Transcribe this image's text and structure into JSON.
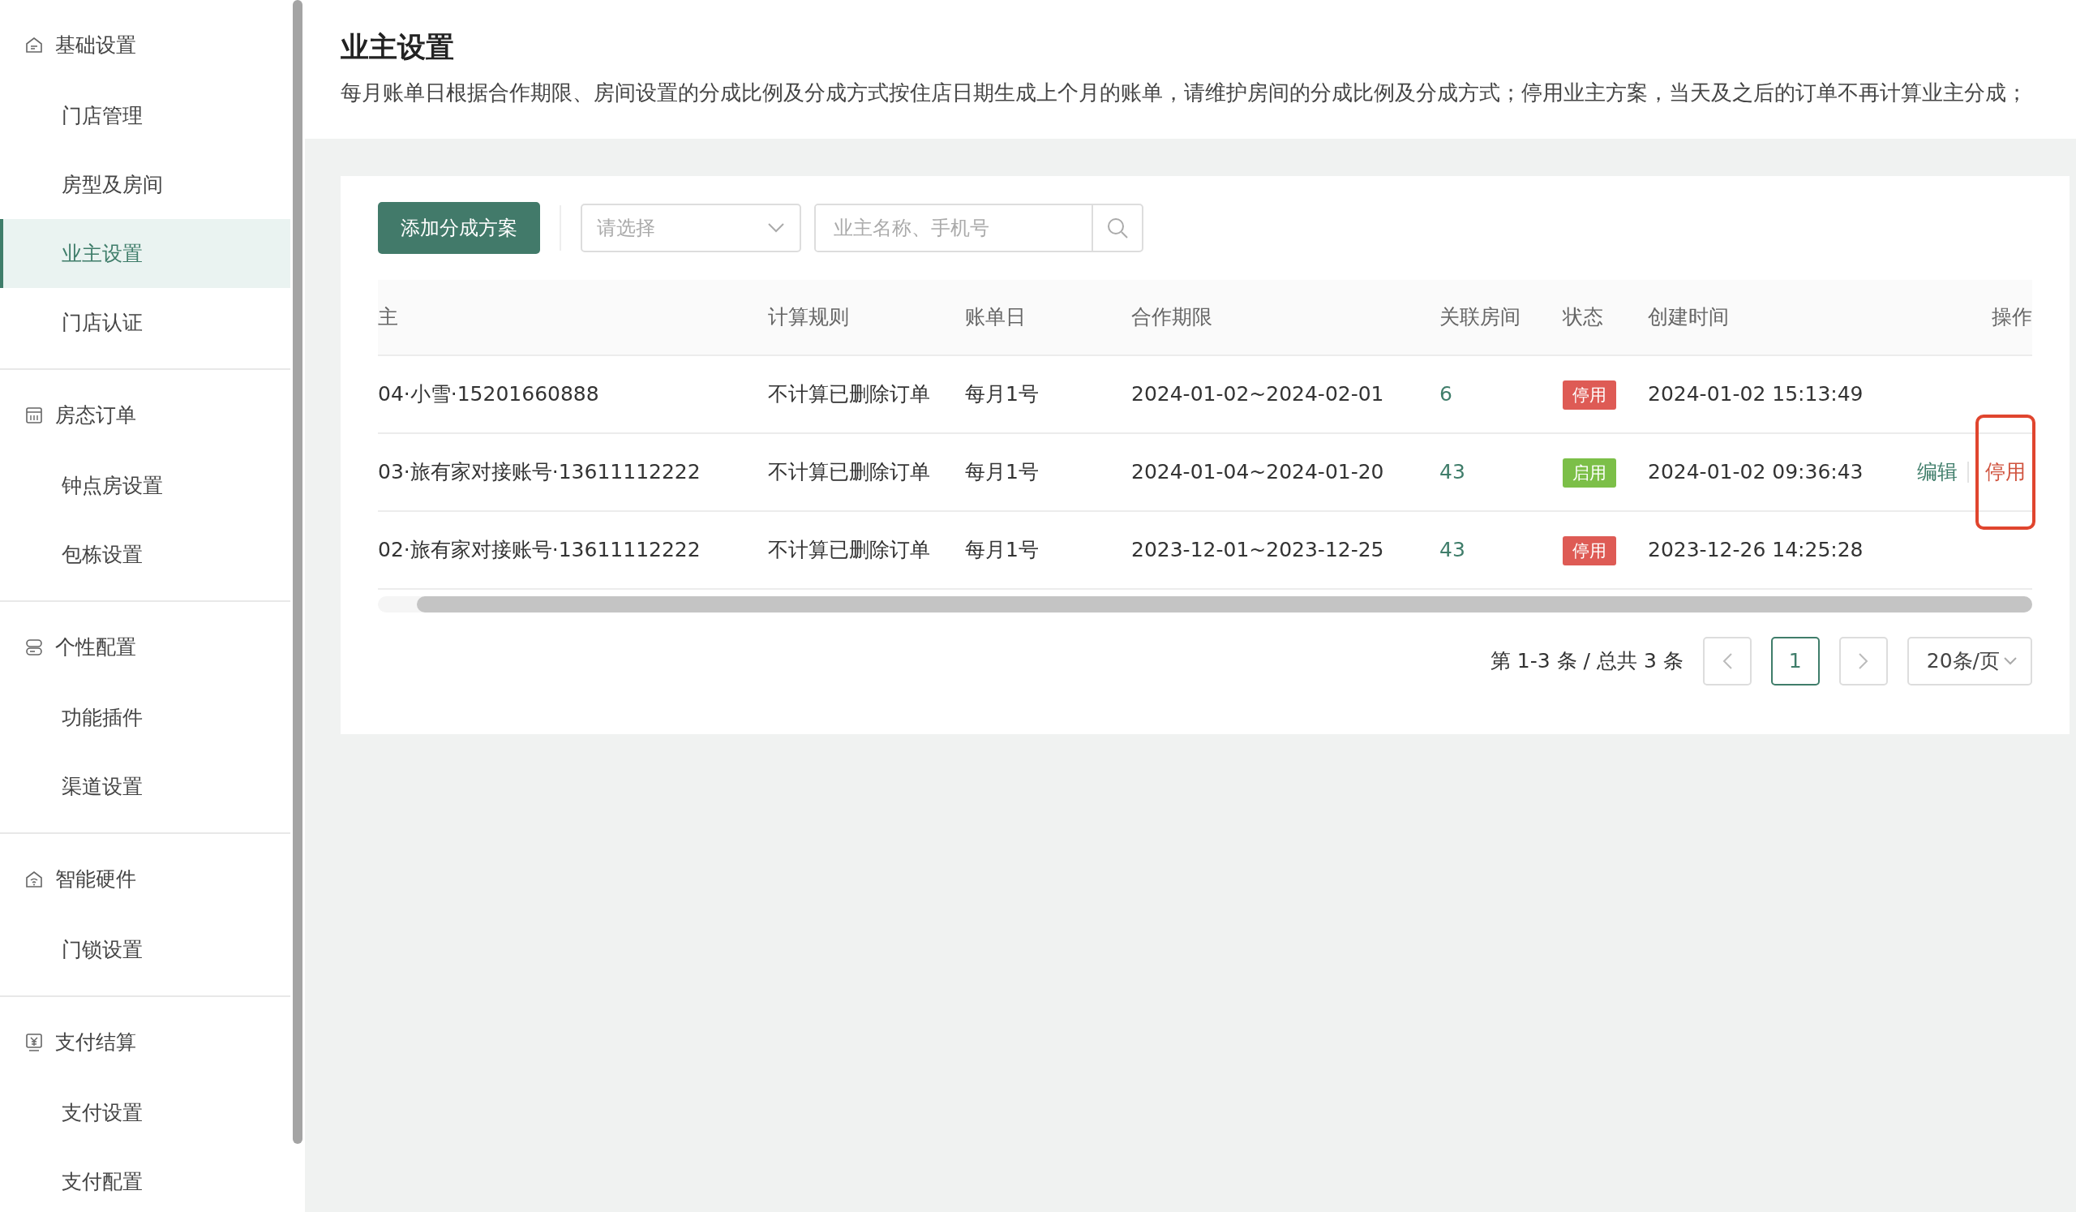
{
  "sidebar": {
    "groups": [
      {
        "title": "基础设置",
        "items": [
          {
            "label": "门店管理",
            "selected": false
          },
          {
            "label": "房型及房间",
            "selected": false
          },
          {
            "label": "业主设置",
            "selected": true
          },
          {
            "label": "门店认证",
            "selected": false
          }
        ]
      },
      {
        "title": "房态订单",
        "items": [
          {
            "label": "钟点房设置",
            "selected": false
          },
          {
            "label": "包栋设置",
            "selected": false
          }
        ]
      },
      {
        "title": "个性配置",
        "items": [
          {
            "label": "功能插件",
            "selected": false
          },
          {
            "label": "渠道设置",
            "selected": false
          }
        ]
      },
      {
        "title": "智能硬件",
        "items": [
          {
            "label": "门锁设置",
            "selected": false
          }
        ]
      },
      {
        "title": "支付结算",
        "items": [
          {
            "label": "支付设置",
            "selected": false
          },
          {
            "label": "支付配置",
            "selected": false
          }
        ]
      }
    ]
  },
  "page": {
    "title": "业主设置",
    "description": "每月账单日根据合作期限、房间设置的分成比例及分成方式按住店日期生成上个月的账单，请维护房间的分成比例及分成方式；停用业主方案，当天及之后的订单不再计算业主分成；"
  },
  "toolbar": {
    "add_button": "添加分成方案",
    "status_select": {
      "placeholder": "请选择"
    },
    "search": {
      "placeholder": "业主名称、手机号"
    }
  },
  "table": {
    "columns": [
      "主",
      "计算规则",
      "账单日",
      "合作期限",
      "关联房间",
      "状态",
      "创建时间",
      "操作"
    ],
    "rows": [
      {
        "owner": "04·小雪·15201660888",
        "rule": "不计算已删除订单",
        "billing_day": "每月1号",
        "period": "2024-01-02~2024-02-01",
        "rooms": "6",
        "status": {
          "label": "停用",
          "kind": "disabled"
        },
        "created": "2024-01-02 15:13:49",
        "actions": []
      },
      {
        "owner": "03·旅有家对接账号·13611112222",
        "rule": "不计算已删除订单",
        "billing_day": "每月1号",
        "period": "2024-01-04~2024-01-20",
        "rooms": "43",
        "status": {
          "label": "启用",
          "kind": "enabled"
        },
        "created": "2024-01-02 09:36:43",
        "actions": [
          {
            "label": "编辑",
            "kind": "edit",
            "highlighted": false
          },
          {
            "label": "停用",
            "kind": "disable",
            "highlighted": true
          }
        ]
      },
      {
        "owner": "02·旅有家对接账号·13611112222",
        "rule": "不计算已删除订单",
        "billing_day": "每月1号",
        "period": "2023-12-01~2023-12-25",
        "rooms": "43",
        "status": {
          "label": "停用",
          "kind": "disabled"
        },
        "created": "2023-12-26 14:25:28",
        "actions": []
      }
    ]
  },
  "pagination": {
    "summary": "第 1-3 条 / 总共 3 条",
    "pages": [
      {
        "label": "1",
        "selected": true
      }
    ],
    "page_size": "20条/页"
  }
}
